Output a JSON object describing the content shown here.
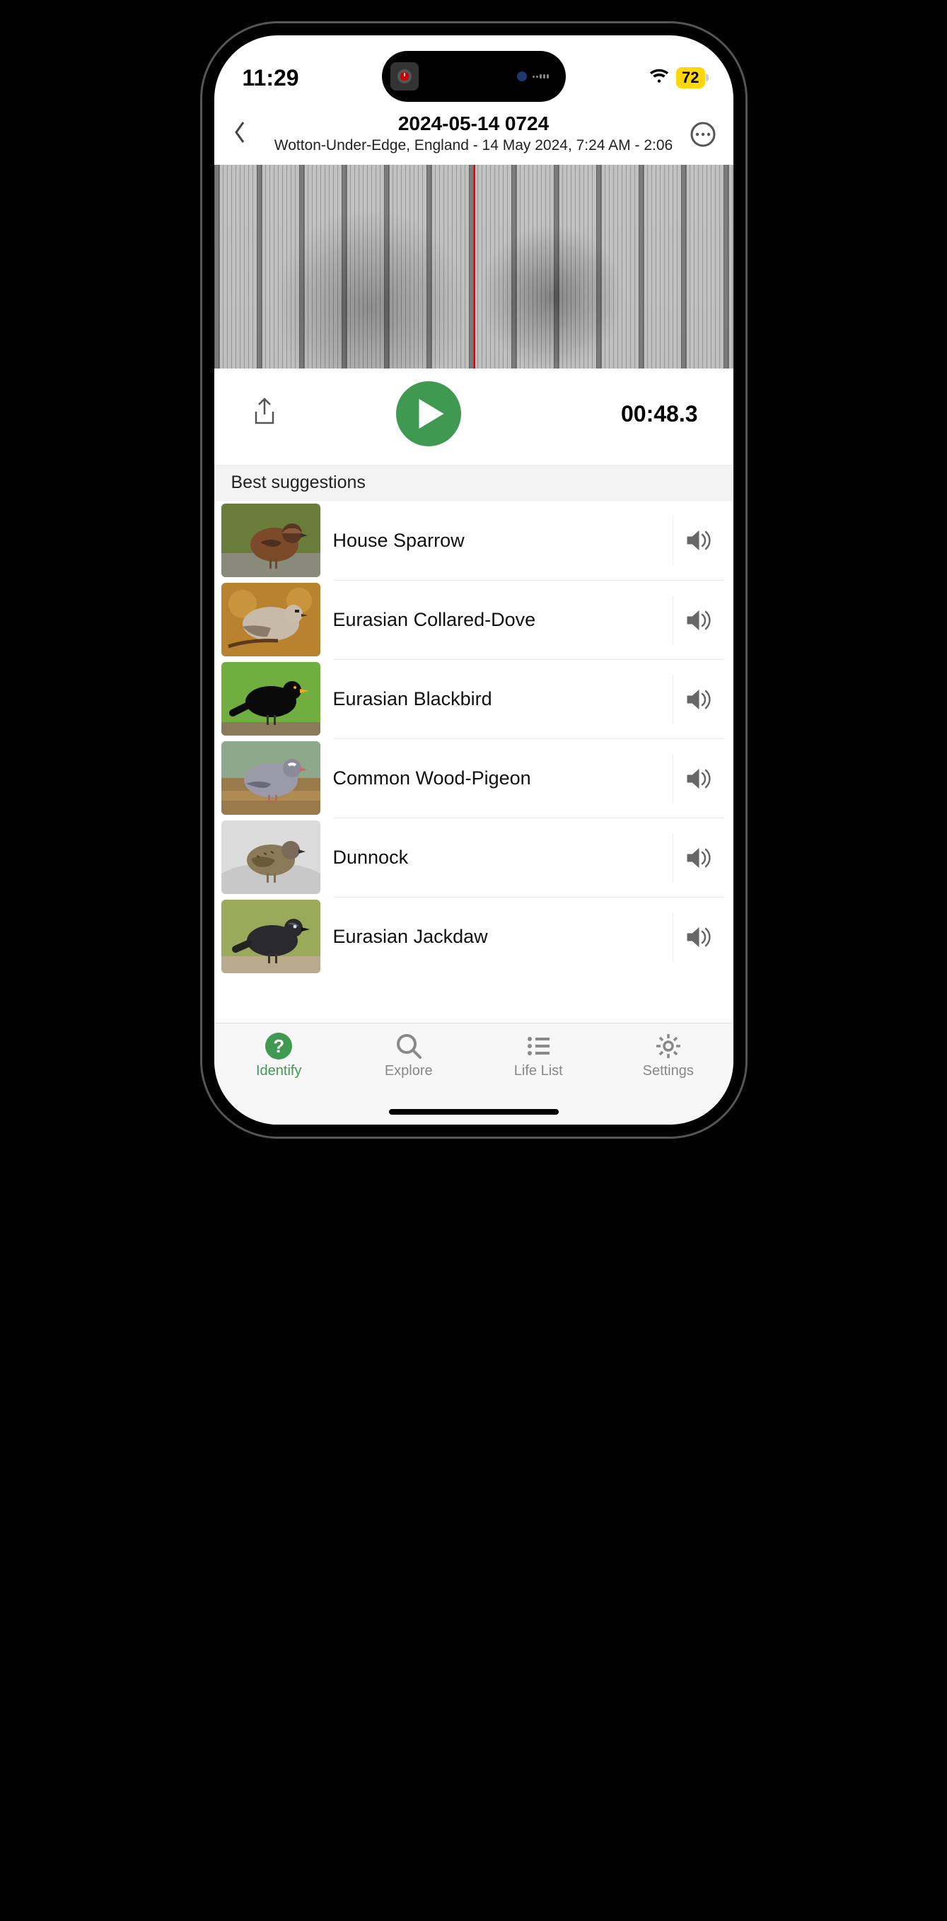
{
  "status": {
    "time": "11:29",
    "battery": "72"
  },
  "header": {
    "title": "2024-05-14 0724",
    "subtitle": "Wotton-Under-Edge, England - 14 May 2024, 7:24 AM - 2:06"
  },
  "playback": {
    "timecode": "00:48.3"
  },
  "section_title": "Best suggestions",
  "suggestions": [
    {
      "name": "House Sparrow",
      "thumb": "sparrow"
    },
    {
      "name": "Eurasian Collared-Dove",
      "thumb": "dove"
    },
    {
      "name": "Eurasian Blackbird",
      "thumb": "blackbird"
    },
    {
      "name": "Common Wood-Pigeon",
      "thumb": "pigeon"
    },
    {
      "name": "Dunnock",
      "thumb": "dunnock"
    },
    {
      "name": "Eurasian Jackdaw",
      "thumb": "jackdaw"
    }
  ],
  "tabs": [
    {
      "label": "Identify",
      "icon": "identify",
      "active": true
    },
    {
      "label": "Explore",
      "icon": "search",
      "active": false
    },
    {
      "label": "Life List",
      "icon": "list",
      "active": false
    },
    {
      "label": "Settings",
      "icon": "gear",
      "active": false
    }
  ]
}
